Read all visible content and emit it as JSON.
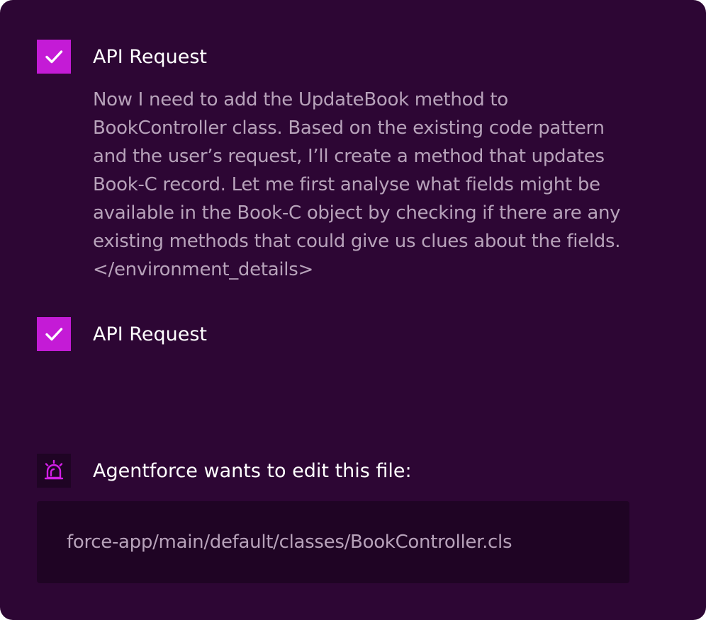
{
  "steps": [
    {
      "icon": "checkmark-icon",
      "label": "API Request",
      "message_lines": [
        "Now I need to add the UpdateBook method to",
        "BookController class. Based on the existing code pattern",
        "and the user’s request, I’ll create a method that updates",
        "Book-C record. Let me first analyse what fields might be",
        "available in the Book-C object by checking if there are any",
        "existing methods that could give us clues about the fields.",
        "</environment_details>"
      ]
    },
    {
      "icon": "checkmark-icon",
      "label": "API Request"
    }
  ],
  "edit_request": {
    "icon": "alarm-icon",
    "label": "Agentforce wants to edit this file:",
    "file_path": "force-app/main/default/classes/BookController.cls"
  },
  "colors": {
    "panel_background": "#2d0634",
    "check_background": "#c41bd6",
    "muted_text": "#b7a2ba",
    "file_box_background": "#1f0424",
    "alarm_icon": "#d21fe6"
  }
}
